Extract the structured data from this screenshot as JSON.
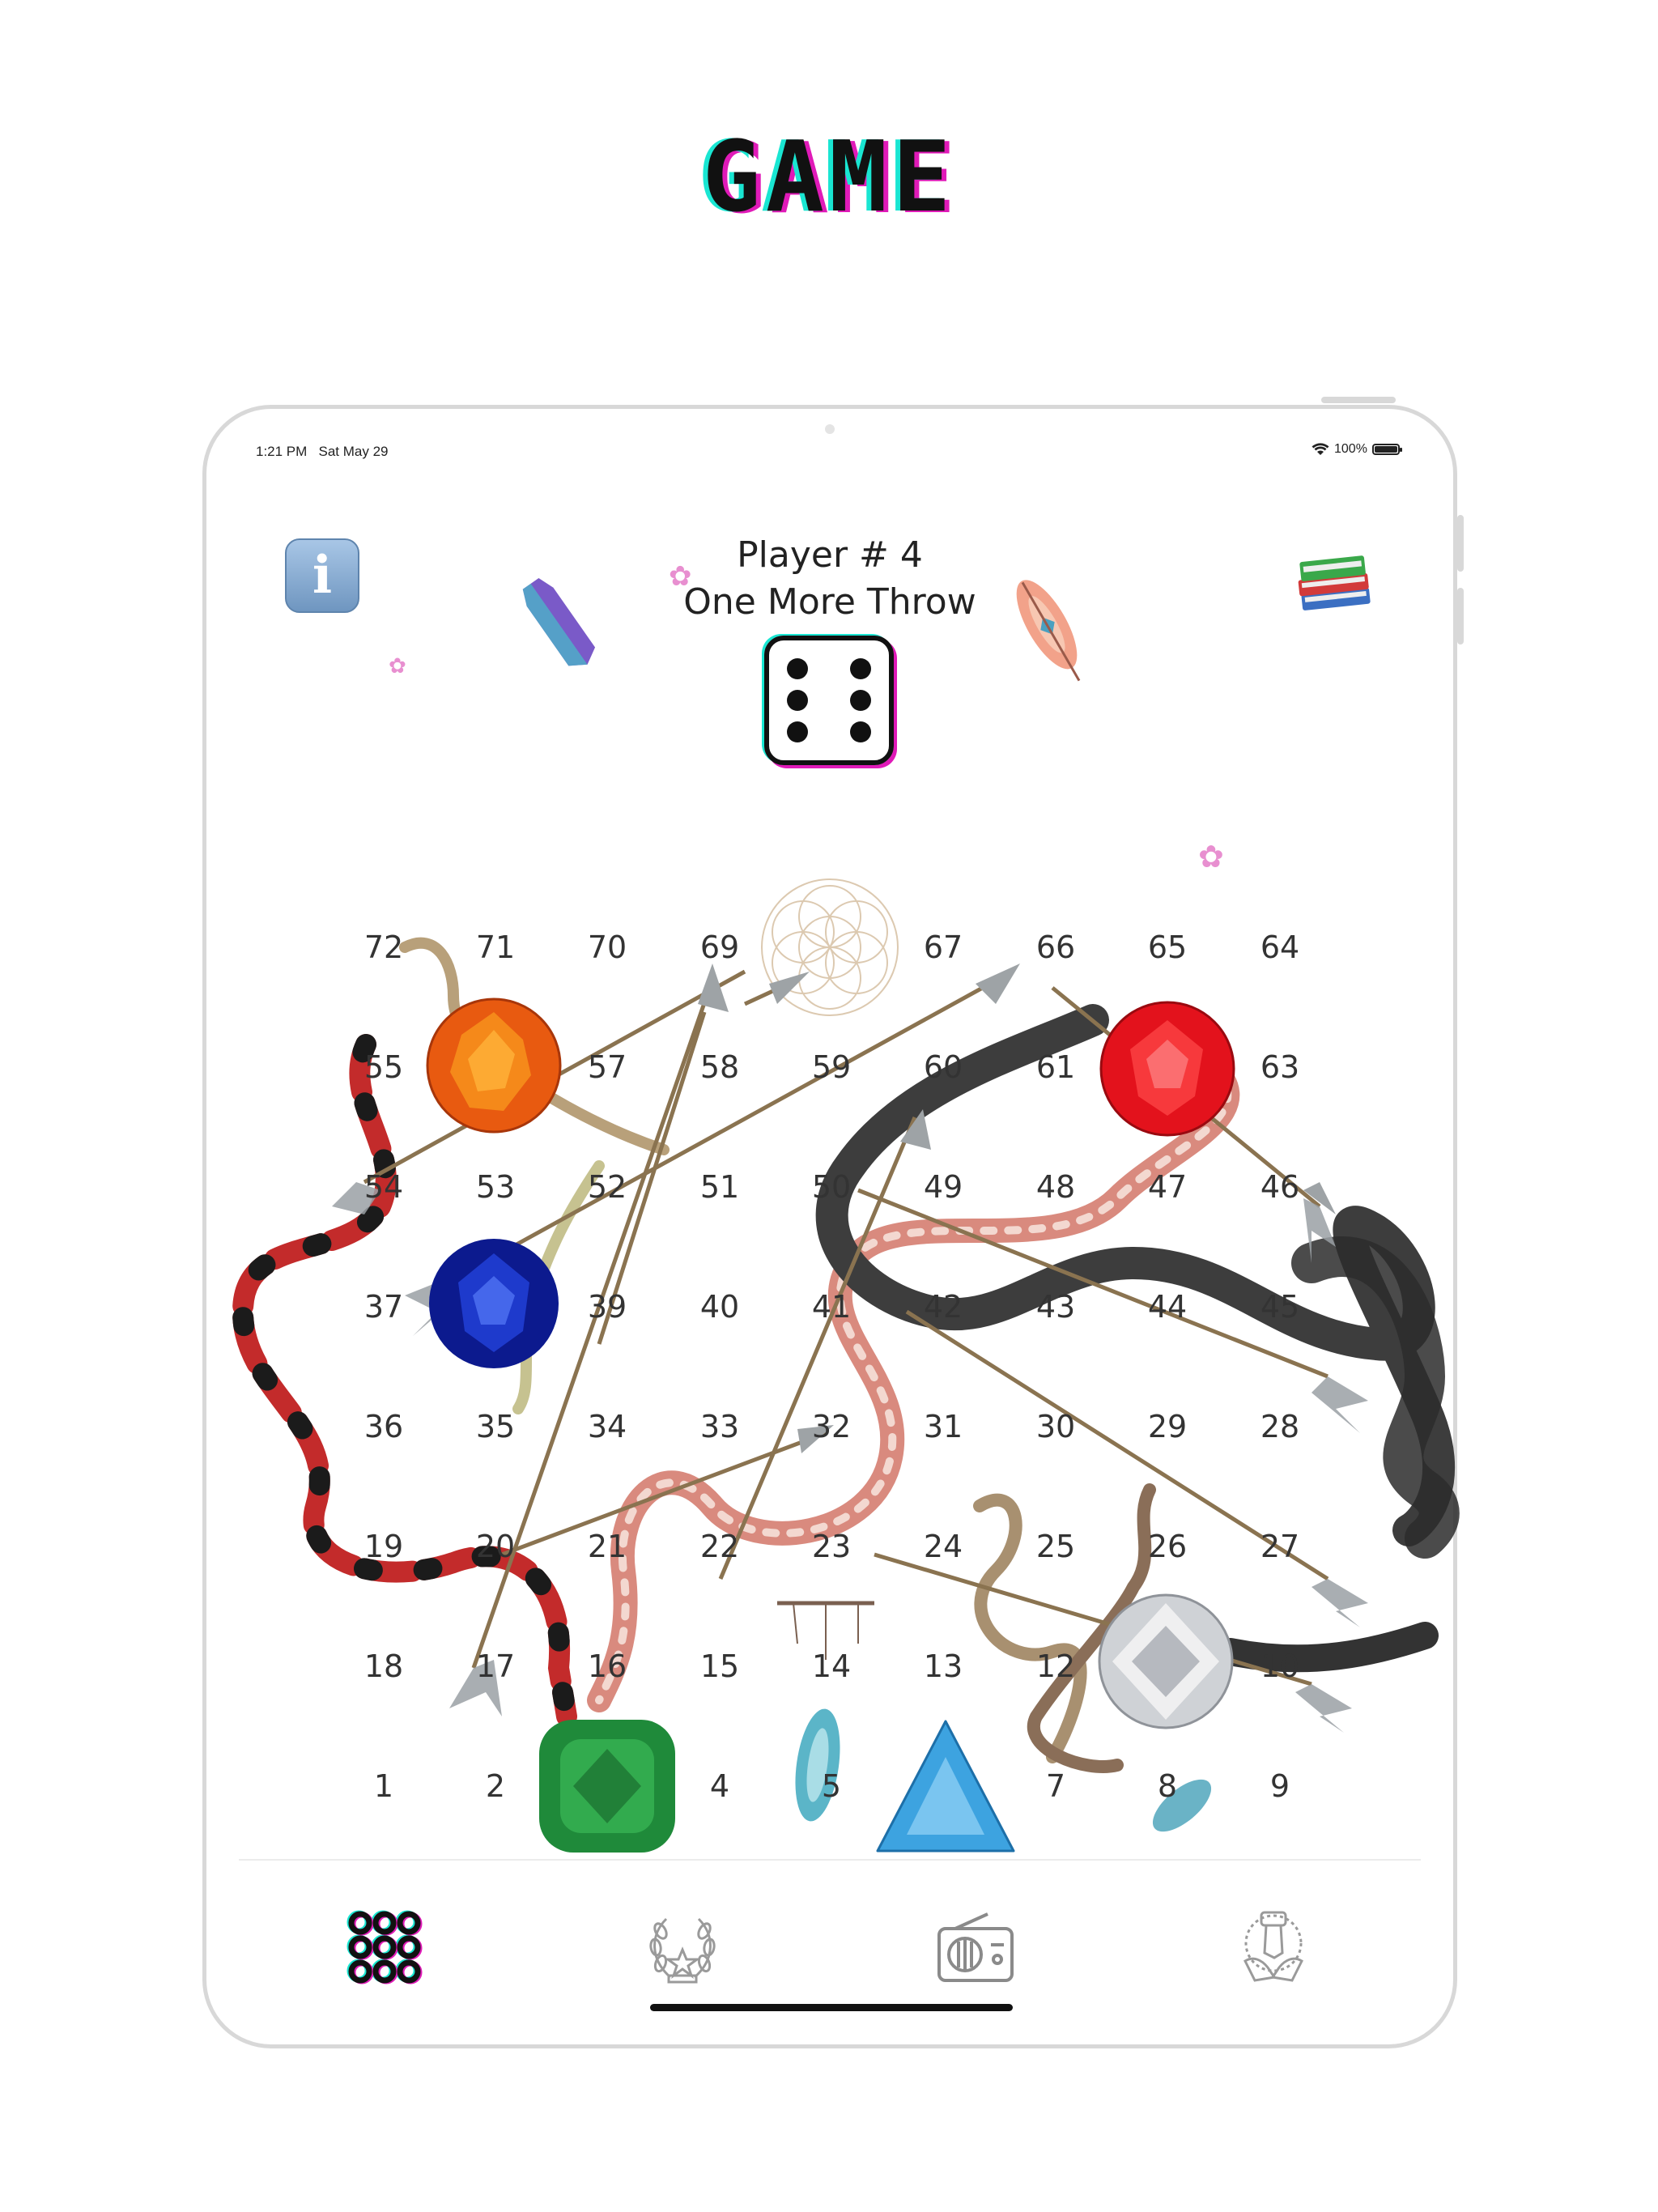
{
  "page": {
    "title": "GAME"
  },
  "status_bar": {
    "time": "1:21 PM",
    "date": "Sat May 29",
    "battery": "100%"
  },
  "header": {
    "info_icon": "info-icon",
    "books_icon": "books-icon",
    "player_label": "Player # 4",
    "message": "One More Throw",
    "dice_value": 6
  },
  "board": {
    "rows": [
      [
        "72",
        "71",
        "70",
        "69",
        "67",
        "66",
        "65",
        "64"
      ],
      [
        "55",
        "57",
        "58",
        "59",
        "60",
        "61",
        "63"
      ],
      [
        "54",
        "53",
        "52",
        "51",
        "50",
        "49",
        "48",
        "47",
        "46"
      ],
      [
        "37",
        "39",
        "40",
        "41",
        "42",
        "43",
        "44",
        "45"
      ],
      [
        "36",
        "35",
        "34",
        "33",
        "32",
        "31",
        "30",
        "29",
        "28"
      ],
      [
        "19",
        "20",
        "21",
        "22",
        "23",
        "24",
        "25",
        "26",
        "27"
      ],
      [
        "18",
        "17",
        "16",
        "15",
        "14",
        "13",
        "12",
        "10"
      ],
      [
        "1",
        "2",
        "4",
        "5",
        "7",
        "8",
        "9"
      ]
    ]
  },
  "tabbar": {
    "tabs": [
      {
        "icon": "game-grid-icon"
      },
      {
        "icon": "laurel-trophy-icon"
      },
      {
        "icon": "radio-icon"
      },
      {
        "icon": "helping-hands-icon"
      }
    ]
  }
}
